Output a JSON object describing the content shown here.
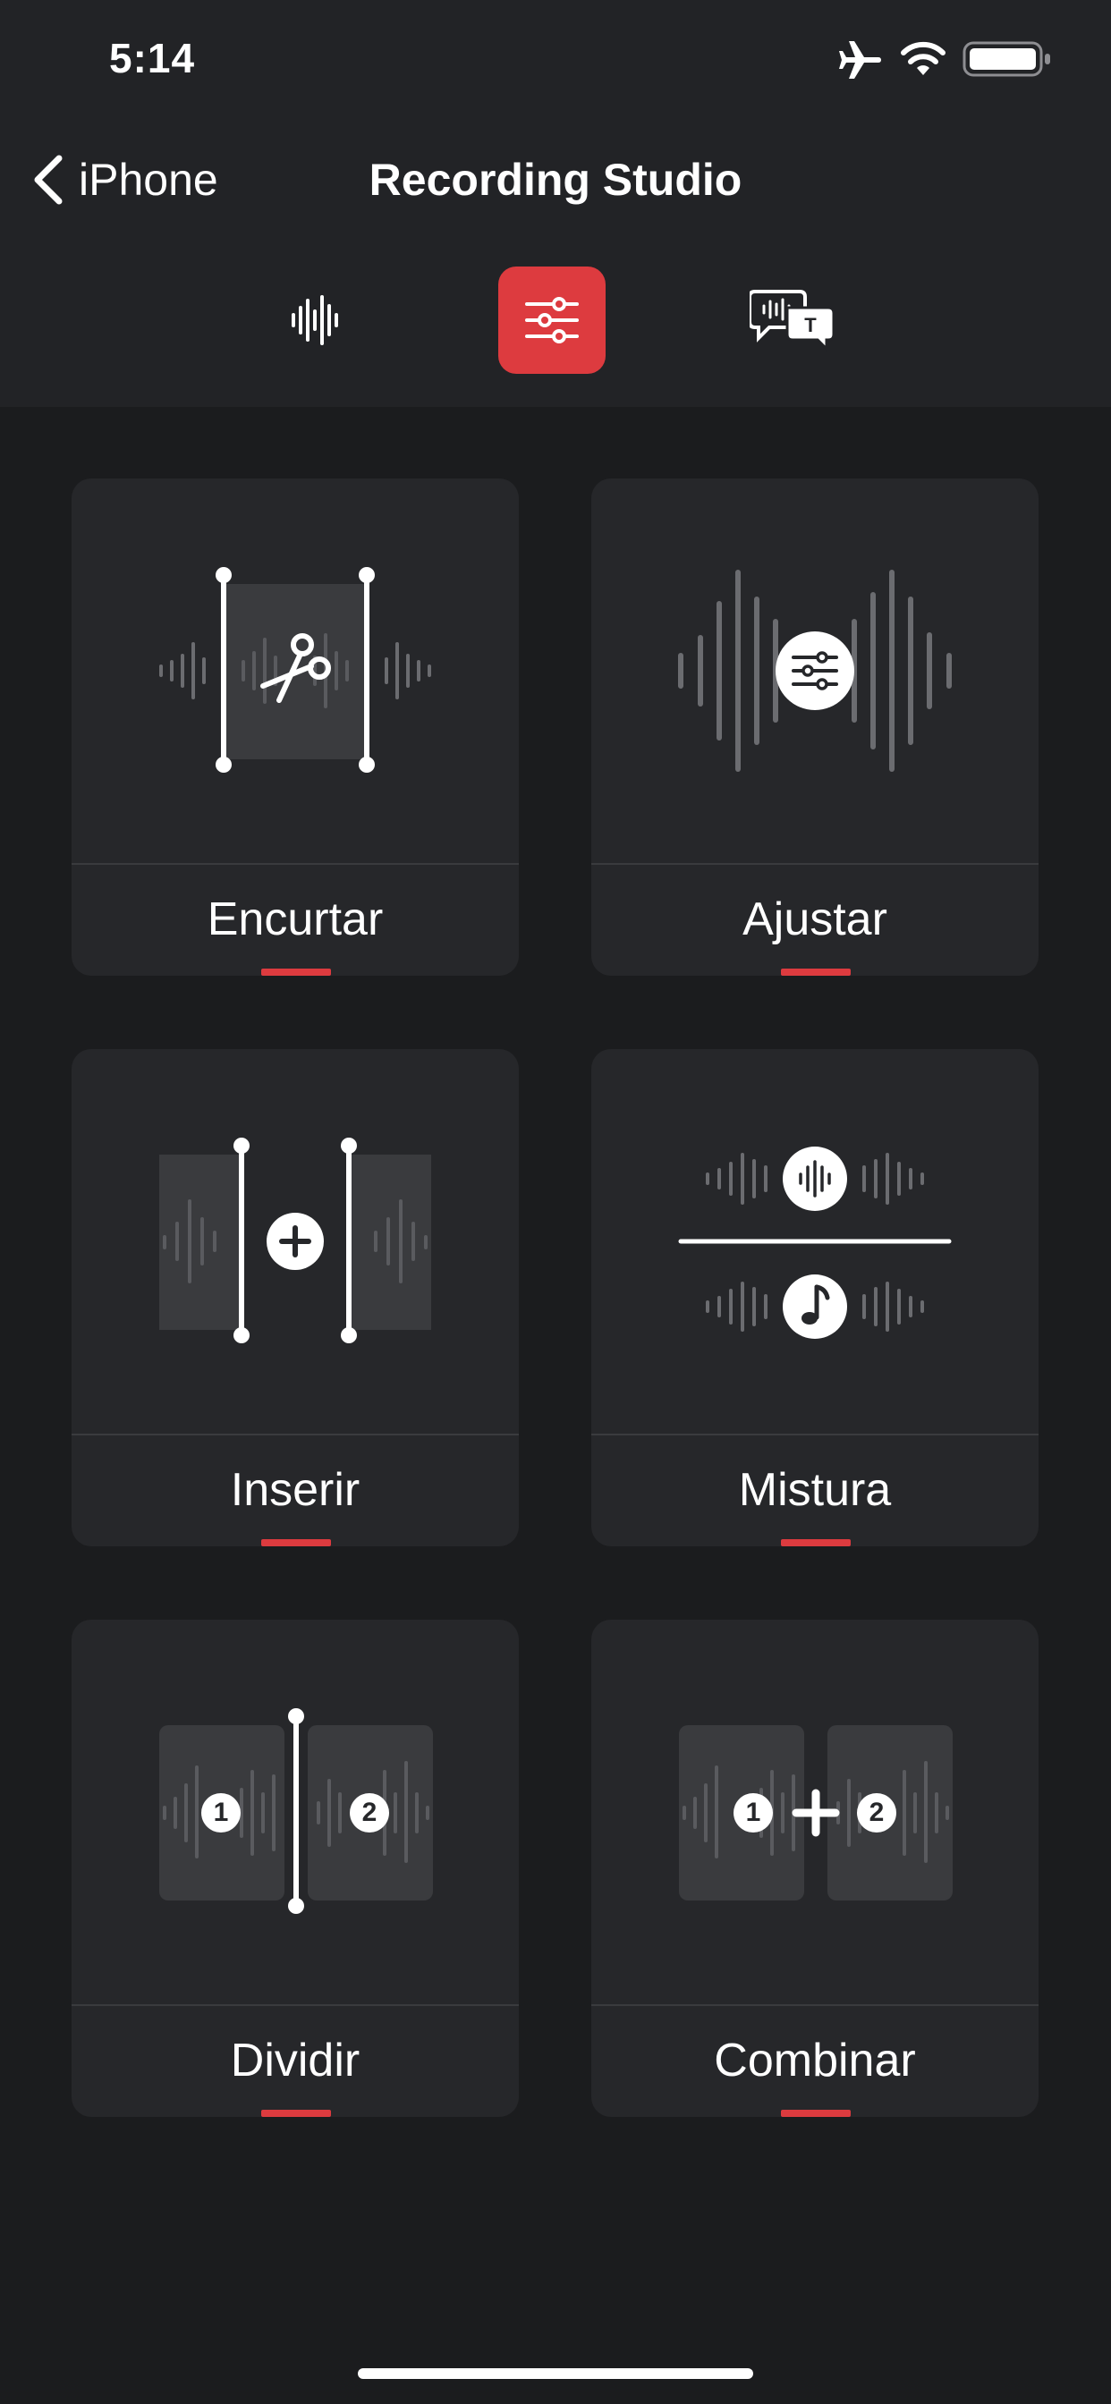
{
  "status_bar": {
    "time": "5:14",
    "icons": [
      "airplane-icon",
      "wifi-icon",
      "battery-icon"
    ]
  },
  "nav": {
    "back_label": "iPhone",
    "title": "Recording Studio"
  },
  "mode_tabs": [
    {
      "icon": "waveform-icon",
      "active": false
    },
    {
      "icon": "sliders-icon",
      "active": true
    },
    {
      "icon": "transcript-icon",
      "active": false
    }
  ],
  "tools": [
    {
      "label": "Encurtar",
      "icon": "trim-scissors-icon"
    },
    {
      "label": "Ajustar",
      "icon": "adjust-sliders-icon"
    },
    {
      "label": "Inserir",
      "icon": "insert-plus-icon"
    },
    {
      "label": "Mistura",
      "icon": "mix-music-icon"
    },
    {
      "label": "Dividir",
      "icon": "split-icon",
      "segment_labels": [
        "1",
        "2"
      ]
    },
    {
      "label": "Combinar",
      "icon": "combine-icon",
      "segment_labels": [
        "1",
        "2"
      ]
    }
  ],
  "colors": {
    "accent": "#dd3b3f",
    "background": "#1b1c1e",
    "header": "#222326",
    "card": "#26272a"
  }
}
